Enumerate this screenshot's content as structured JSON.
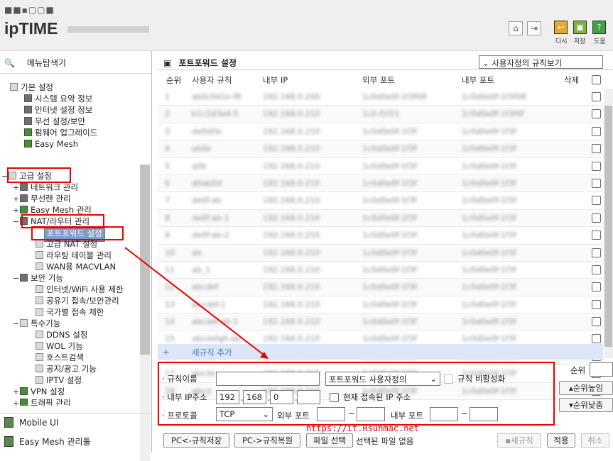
{
  "header": {
    "logo_dots": "■■▪▢▢■",
    "logo_bold": "ipTIME",
    "home_icon": "home-icon",
    "logout_icon": "logout-icon",
    "restart_label": "다시",
    "save_label": "저장",
    "help_label": "도움"
  },
  "sidebar": {
    "title": "메뉴탐색기",
    "basic": {
      "label": "기본 설정",
      "items": [
        "시스템 요약 정보",
        "인터넷 설정 정보",
        "무선 설정/보안",
        "펌웨어 업그레이드",
        "Easy Mesh"
      ]
    },
    "advanced": {
      "label": "고급 설정",
      "items": {
        "network": "네트워크 관리",
        "wireless": "무선랜 관리",
        "easymesh": "Easy Mesh 관리",
        "nat": "NAT/라우터 관리",
        "nat_children": [
          "포트포워드 설정",
          "고급 NAT 설정",
          "라우팅 테이블 관리",
          "WAN용 MACVLAN"
        ],
        "security": "보안 기능",
        "security_children": [
          "인터넷/WiFi 사용 제한",
          "공유기 접속/보안관리",
          "국가별 접속 제한"
        ],
        "special": "특수기능",
        "special_children": [
          "DDNS 설정",
          "WOL 기능",
          "호스트검색",
          "공지/광고 기능",
          "IPTV 설정"
        ],
        "vpn": "VPN 설정",
        "traffic": "트래픽 관리"
      }
    },
    "footer": [
      "Mobile UI",
      "Easy Mesh 관리툴"
    ]
  },
  "main": {
    "title": "포트포워드 설정",
    "view_select": "사용자정의 규칙보기",
    "columns": {
      "index": "순위",
      "rule": "사용자 규칙",
      "internal_ip": "내부 IP",
      "external_port": "외부 포트",
      "internal_port": "내부 포트",
      "delete": "삭제"
    },
    "rows": [
      {
        "idx": "1",
        "rule": "ab0c0d1e-f8",
        "ip": "192.168.0.200",
        "ext": "1c0d0e0f-1f3f08",
        "int": "1c0d0e0f-1f3f08"
      },
      {
        "idx": "2",
        "rule": "b1c2d3e4-5",
        "ip": "192.168.0.210",
        "ext": "1c0-f1f21",
        "int": "1c0d0e0f-1f3f0f"
      },
      {
        "idx": "3",
        "rule": "de0d0e",
        "ip": "192.168.0.210",
        "ext": "1c0d0e0f-1f3f",
        "int": "1c0d0e0f-1f3f"
      },
      {
        "idx": "4",
        "rule": "ab0e",
        "ip": "192.168.0.210",
        "ext": "1c0d0e0f-1f3f",
        "int": "1c0d0e0f-1f3f"
      },
      {
        "idx": "5",
        "rule": "a0b",
        "ip": "192.168.0.210",
        "ext": "1c0d0e0f-1f3f",
        "int": "1c0d0e0f-1f3f"
      },
      {
        "idx": "6",
        "rule": "d0ab0d",
        "ip": "192.168.0.210",
        "ext": "1c0d0e0f-1f3f",
        "int": "1c0d0e0f-1f3f"
      },
      {
        "idx": "7",
        "rule": "de0f-ab",
        "ip": "192.168.0.210",
        "ext": "1c0d0e0f-1f3f",
        "int": "1c0d0e0f-1f3f"
      },
      {
        "idx": "8",
        "rule": "de0f-ab-1",
        "ip": "192.168.0.210",
        "ext": "1c0d0e0f-1f3f",
        "int": "1c0d0e0f-1f3f"
      },
      {
        "idx": "9",
        "rule": "de0f-ab-2",
        "ip": "192.168.0.210",
        "ext": "1c0d0e0f-1f3f",
        "int": "1c0d0e0f-1f3f"
      },
      {
        "idx": "10",
        "rule": "ab",
        "ip": "192.168.0.210",
        "ext": "1c0d0e0f-1f3f",
        "int": "1c0d0e0f-1f3f"
      },
      {
        "idx": "11",
        "rule": "ab_1",
        "ip": "192.168.0.210",
        "ext": "1c0d0e0f-1f3f",
        "int": "1c0d0e0f-1f3f"
      },
      {
        "idx": "12",
        "rule": "abcdef",
        "ip": "192.168.0.210",
        "ext": "1c0d0e0f-1f3f",
        "int": "1c0d0e0f-1f3f"
      },
      {
        "idx": "13",
        "rule": "abcdef-1",
        "ip": "192.168.0.210",
        "ext": "1c0d0e0f-1f3f",
        "int": "1c0d0e0f-1f3f"
      },
      {
        "idx": "14",
        "rule": "abcdef-ab-1",
        "ip": "192.168.0.210",
        "ext": "1c0d0e0f-1f3f",
        "int": "1c0d0e0f-1f3f"
      },
      {
        "idx": "15",
        "rule": "abcdefgh-ab",
        "ip": "192.168.0.210",
        "ext": "1c0d0e0f-1f3f",
        "int": "1c0d0e0f-1f3f"
      },
      {
        "idx": "16",
        "rule": "abcde",
        "ip": "192.168.0.210",
        "ext": "1c0d0e0f-1f3f",
        "int": "1c0d0e0f-1f3f"
      },
      {
        "idx": "17",
        "rule": "abcde",
        "ip": "192.168.0.210",
        "ext": "1c0d0e0f-1f3f",
        "int": "1c0d0e0f-1f3f"
      },
      {
        "idx": "18",
        "rule": "abcd",
        "ip": "192.168.0.210",
        "ext": "1c0d0e0f-1f3f",
        "int": "1c0d0e0f-1f3f"
      }
    ],
    "add_rule": "새규칙 추가"
  },
  "form": {
    "rule_name_label": "규칙이름",
    "rule_name_value": "",
    "service_select": "포트포워드 사용자정의",
    "disable_label": "규칙 비활성화",
    "ip_label": "내부 IP주소",
    "ip1": "192",
    "ip2": "168",
    "ip3": "0",
    "ip4": "",
    "current_ip_label": "현재 접속된 IP 주소",
    "protocol_label": "프로토콜",
    "protocol_value": "TCP",
    "ext_port_label": "외부 포트",
    "int_port_label": "내부 포트",
    "tilde": "~"
  },
  "order": {
    "label": "순위",
    "up": "순위높임",
    "down": "순위낮춤"
  },
  "bottom": {
    "save_to_pc": "PC<-규칙저장",
    "restore_from_pc": "PC->규칙복원",
    "file_select": "파일 선택",
    "no_file": "선택된 파일 없음",
    "new_rule": "새규칙",
    "apply": "적용",
    "cancel": "취소"
  },
  "watermark": "https://it.Rsuhmac.net"
}
